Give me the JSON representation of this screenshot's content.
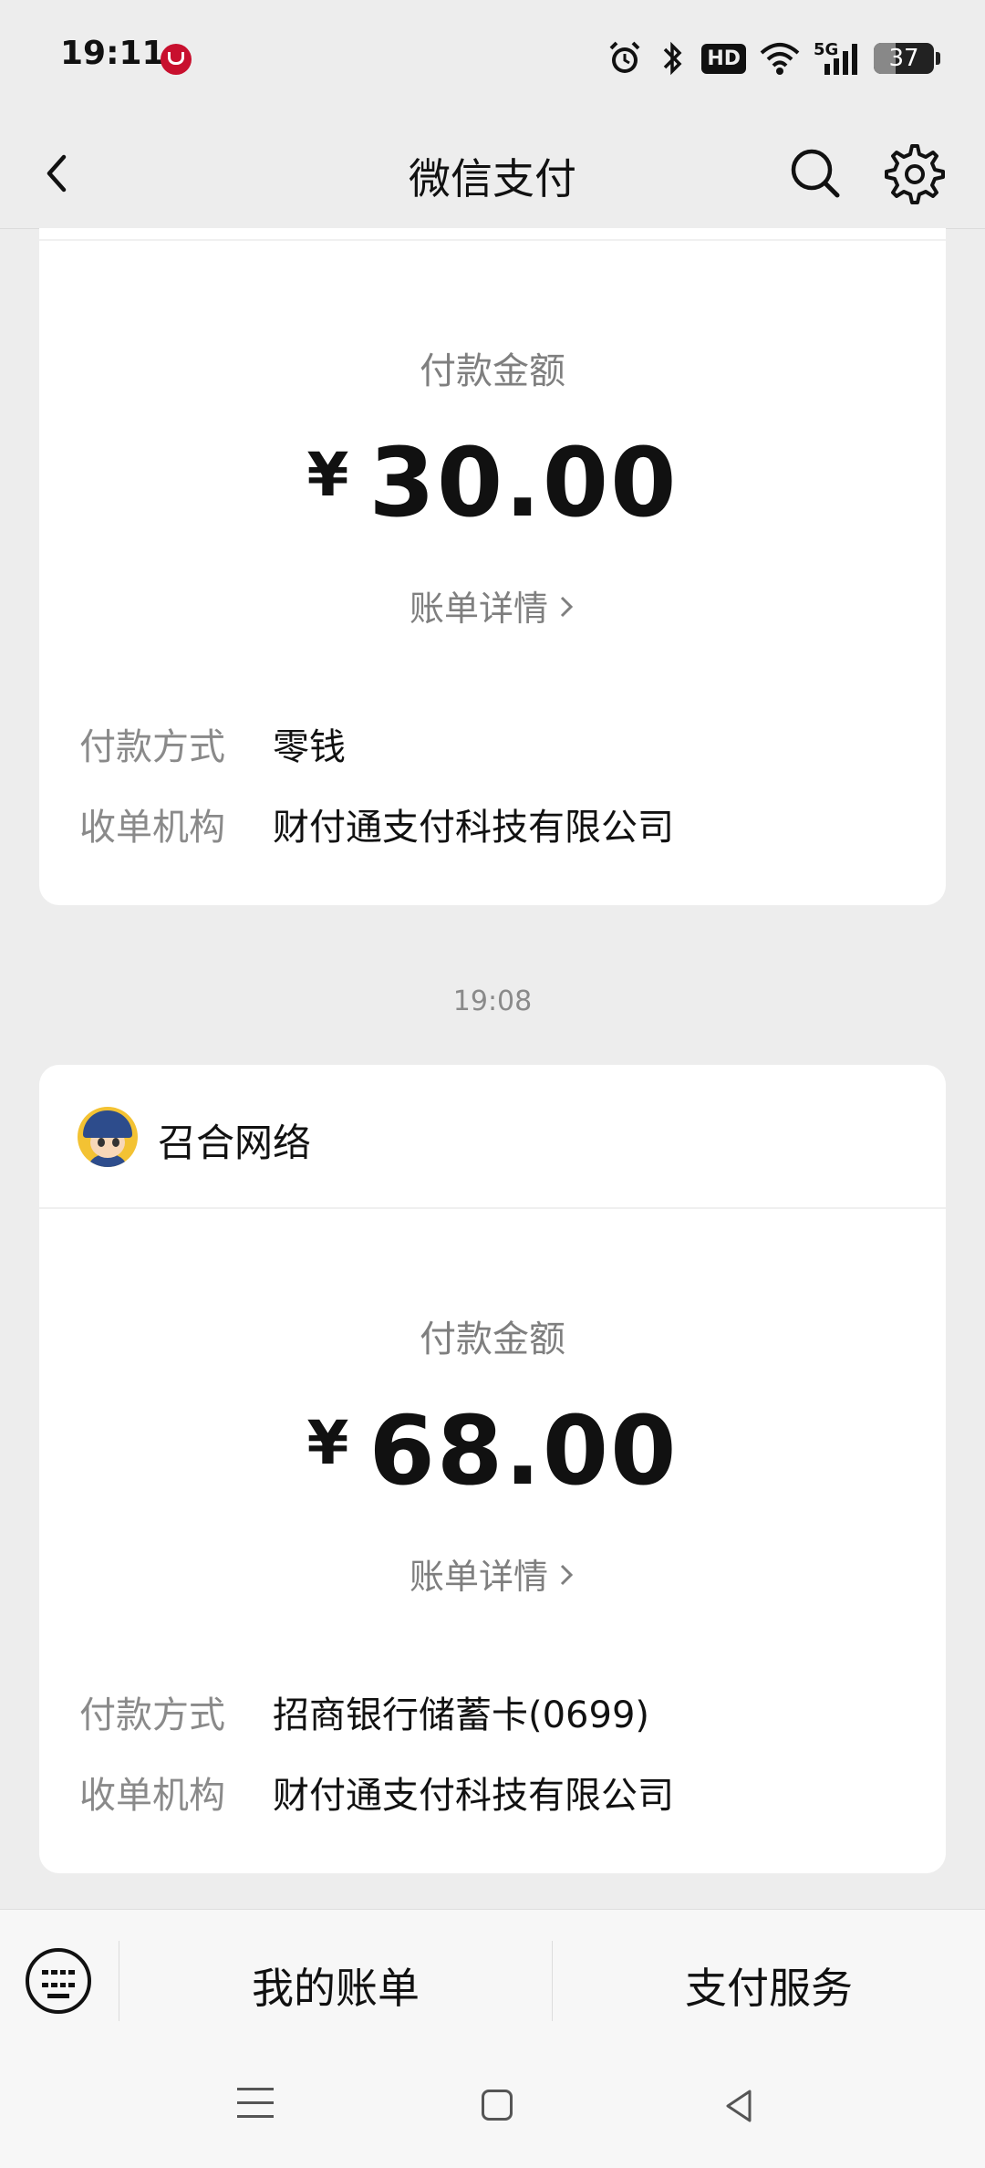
{
  "status_bar": {
    "time": "19:11",
    "icons": [
      "cmb-app-icon",
      "alarm-icon",
      "bluetooth-icon",
      "hd-icon",
      "wifi-icon",
      "5g-signal-icon"
    ],
    "hd_label": "HD",
    "network_label": "5G",
    "battery_level": "37"
  },
  "nav": {
    "title": "微信支付",
    "back_icon": "chevron-left-icon",
    "search_icon": "search-icon",
    "settings_icon": "gear-icon"
  },
  "transactions": [
    {
      "amount_label": "付款金额",
      "currency": "¥",
      "amount": "30.00",
      "detail_link": "账单详情",
      "rows": [
        {
          "key": "付款方式",
          "value": "零钱"
        },
        {
          "key": "收单机构",
          "value": "财付通支付科技有限公司"
        }
      ]
    },
    {
      "time": "19:08",
      "merchant": "召合网络",
      "amount_label": "付款金额",
      "currency": "¥",
      "amount": "68.00",
      "detail_link": "账单详情",
      "rows": [
        {
          "key": "付款方式",
          "value": "招商银行储蓄卡(0699)"
        },
        {
          "key": "收单机构",
          "value": "财付通支付科技有限公司"
        }
      ]
    }
  ],
  "bottom_menu": {
    "keyboard_icon": "keyboard-icon",
    "my_bill": "我的账单",
    "pay_service": "支付服务"
  },
  "system_nav": [
    "menu-icon",
    "home-icon",
    "back-triangle-icon"
  ],
  "colors": {
    "background": "#ededed",
    "card": "#ffffff",
    "muted_text": "#7f7f7f"
  }
}
